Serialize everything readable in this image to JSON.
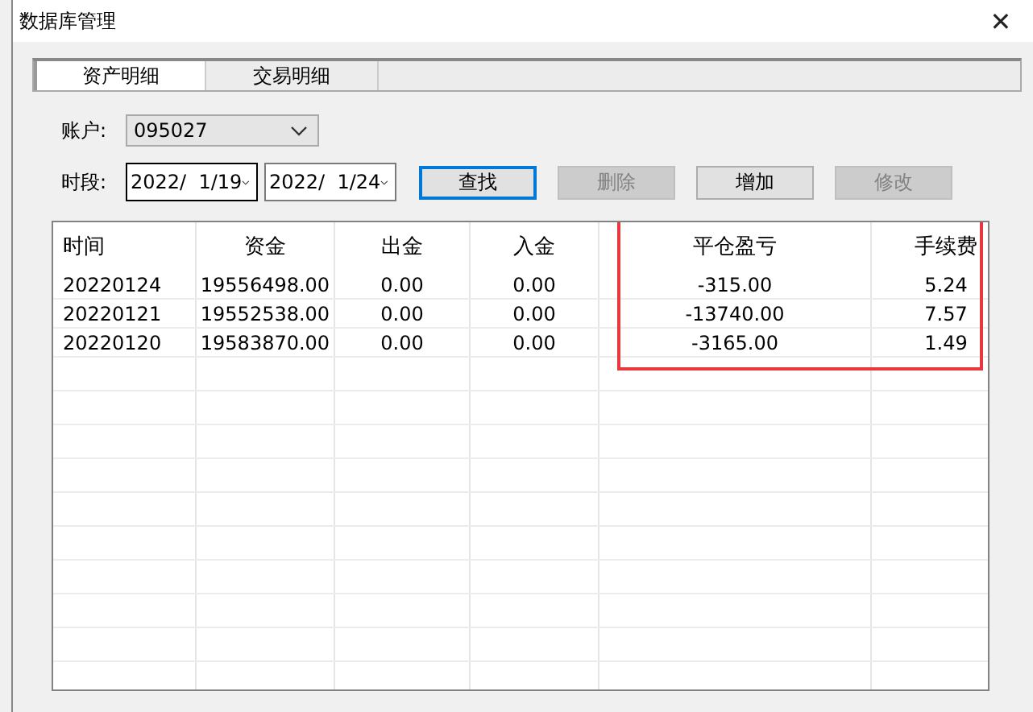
{
  "window": {
    "title": "数据库管理",
    "close": "✕"
  },
  "tabs": [
    {
      "label": "资产明细",
      "selected": true
    },
    {
      "label": "交易明细",
      "selected": false
    }
  ],
  "account": {
    "label": "账户:",
    "value": "095027"
  },
  "period": {
    "label": "时段:",
    "from": "2022/  1/19",
    "to": "2022/  1/24"
  },
  "buttons": [
    {
      "label": "查找",
      "disabled": false,
      "focused": true
    },
    {
      "label": "删除",
      "disabled": true,
      "focused": false
    },
    {
      "label": "增加",
      "disabled": false,
      "focused": false
    },
    {
      "label": "修改",
      "disabled": true,
      "focused": false
    }
  ],
  "table": {
    "columns": [
      "时间",
      "资金",
      "出金",
      "入金",
      "平仓盈亏",
      "手续费"
    ],
    "rows": [
      [
        "20220124",
        "19556498.00",
        "0.00",
        "0.00",
        "-315.00",
        "5.24"
      ],
      [
        "20220121",
        "19552538.00",
        "0.00",
        "0.00",
        "-13740.00",
        "7.57"
      ],
      [
        "20220120",
        "19583870.00",
        "0.00",
        "0.00",
        "-3165.00",
        "1.49"
      ]
    ]
  }
}
